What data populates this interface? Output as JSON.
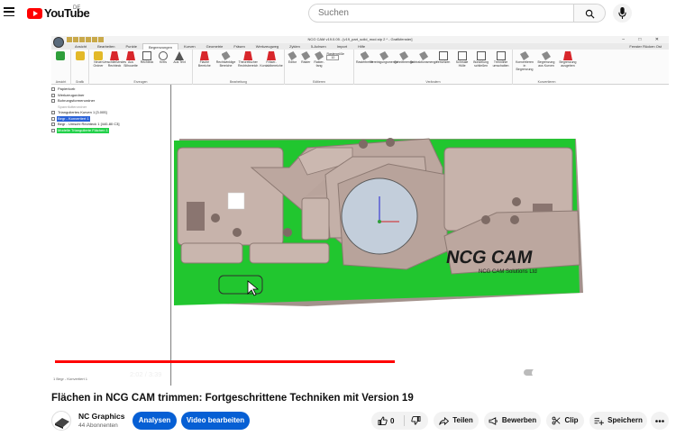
{
  "masthead": {
    "logo_text": "YouTube",
    "country_code": "DE",
    "search_placeholder": "Suchen"
  },
  "app": {
    "window_title": "NCG CAM v19.0.05 - [v19_part_solid_mod.stp 2 * - Grafikfenster]",
    "ribbon_tabs": [
      "Ansicht",
      "Bearbeiten",
      "Punkte",
      "Begrenzungen",
      "Kurven",
      "Geometrie",
      "Fräsen",
      "Werkzeugweg",
      "Zyklen",
      "5-Achsen",
      "Import",
      "Hilfe"
    ],
    "active_tab": "Begrenzungen",
    "ribbon_right": "Fenster   Rücken Ost",
    "ribbon_groups": [
      {
        "label": "Ansicht",
        "buttons": []
      },
      {
        "label": "Grafik",
        "buttons": []
      },
      {
        "label": "Erzeugen",
        "buttons": [
          "Neuer Ordner",
          "Umschließendes Rechteck",
          "Aus Silhouette",
          "Rechteck",
          "Kreis",
          "Aus Text"
        ]
      },
      {
        "label": "Bearbeitung",
        "buttons": [
          "Flache Bereiche",
          "Rechtwinklige Bereiche",
          "Theoretischer Rechtsbereich",
          "Fräser-Kontaktbereiche"
        ]
      },
      {
        "label": "Editieren",
        "buttons": [
          "Editor",
          "Raster",
          "Raster-fang"
        ]
      },
      {
        "label": "Verändern",
        "buttons": [
          "Rasterbreite",
          "Vereinigungsmenge",
          "Schnittmenge",
          "Subtraktionsmenge",
          "Versetzen",
          "Schmale Hülle",
          "Bündelung schließen",
          "Trennlinie umschalten"
        ]
      },
      {
        "label": "Konvertieren",
        "buttons": [
          "Konvertieren in Begrenzung",
          "Begrenzung aus Kurven",
          "Begrenzung ausgeben"
        ]
      }
    ],
    "raster_field_label": "Rastergröße",
    "raster_field_value": "10",
    "tree": [
      {
        "label": "Papierkorb",
        "style": "plain"
      },
      {
        "label": "Werkzeugordner",
        "style": "plain"
      },
      {
        "label": "Bohrungsformenordner",
        "style": "plain"
      },
      {
        "label": "Spannfutterordner",
        "style": "muted"
      },
      {
        "label": "Trianguliertes Kurven 1 [3.005]",
        "style": "plain"
      },
      {
        "label": "Begr - Konvertiert 1",
        "style": "blue"
      },
      {
        "label": "Begr - Umschl Rechteck 1 [440-80 C3]",
        "style": "plain"
      },
      {
        "label": "Modelle Triangulierte Flächen 1",
        "style": "green"
      }
    ],
    "statusbar": "1 Begr - Konvertiert 1"
  },
  "player": {
    "current_time": "2:02",
    "duration": "3:39",
    "progress_fraction": 0.557,
    "cc_label": "CC"
  },
  "video": {
    "title": "Flächen in NCG CAM trimmen: Fortgeschrittene Techniken mit Version 19"
  },
  "channel": {
    "name": "NC Graphics",
    "subscribers": "44 Abonnenten"
  },
  "actions": {
    "analytics_label": "Analysen",
    "edit_label": "Video bearbeiten",
    "like_count": "0",
    "share_label": "Teilen",
    "promote_label": "Bewerben",
    "clip_label": "Clip",
    "save_label": "Speichern"
  },
  "colors": {
    "yt_red": "#ff0000",
    "primary_blue": "#065fd4",
    "boundary_green": "#21c62f",
    "part_beige": "#c9b6ae",
    "cam_logo": "#1b1b1b"
  }
}
